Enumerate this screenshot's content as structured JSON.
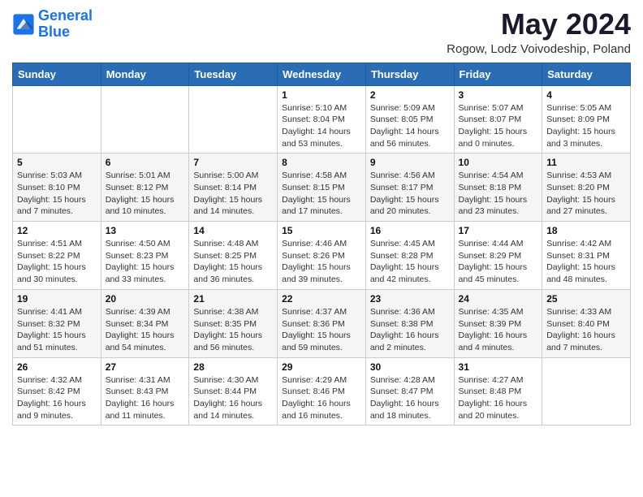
{
  "header": {
    "logo_line1": "General",
    "logo_line2": "Blue",
    "main_title": "May 2024",
    "subtitle": "Rogow, Lodz Voivodeship, Poland"
  },
  "weekdays": [
    "Sunday",
    "Monday",
    "Tuesday",
    "Wednesday",
    "Thursday",
    "Friday",
    "Saturday"
  ],
  "weeks": [
    [
      {
        "day": "",
        "info": ""
      },
      {
        "day": "",
        "info": ""
      },
      {
        "day": "",
        "info": ""
      },
      {
        "day": "1",
        "info": "Sunrise: 5:10 AM\nSunset: 8:04 PM\nDaylight: 14 hours and 53 minutes."
      },
      {
        "day": "2",
        "info": "Sunrise: 5:09 AM\nSunset: 8:05 PM\nDaylight: 14 hours and 56 minutes."
      },
      {
        "day": "3",
        "info": "Sunrise: 5:07 AM\nSunset: 8:07 PM\nDaylight: 15 hours and 0 minutes."
      },
      {
        "day": "4",
        "info": "Sunrise: 5:05 AM\nSunset: 8:09 PM\nDaylight: 15 hours and 3 minutes."
      }
    ],
    [
      {
        "day": "5",
        "info": "Sunrise: 5:03 AM\nSunset: 8:10 PM\nDaylight: 15 hours and 7 minutes."
      },
      {
        "day": "6",
        "info": "Sunrise: 5:01 AM\nSunset: 8:12 PM\nDaylight: 15 hours and 10 minutes."
      },
      {
        "day": "7",
        "info": "Sunrise: 5:00 AM\nSunset: 8:14 PM\nDaylight: 15 hours and 14 minutes."
      },
      {
        "day": "8",
        "info": "Sunrise: 4:58 AM\nSunset: 8:15 PM\nDaylight: 15 hours and 17 minutes."
      },
      {
        "day": "9",
        "info": "Sunrise: 4:56 AM\nSunset: 8:17 PM\nDaylight: 15 hours and 20 minutes."
      },
      {
        "day": "10",
        "info": "Sunrise: 4:54 AM\nSunset: 8:18 PM\nDaylight: 15 hours and 23 minutes."
      },
      {
        "day": "11",
        "info": "Sunrise: 4:53 AM\nSunset: 8:20 PM\nDaylight: 15 hours and 27 minutes."
      }
    ],
    [
      {
        "day": "12",
        "info": "Sunrise: 4:51 AM\nSunset: 8:22 PM\nDaylight: 15 hours and 30 minutes."
      },
      {
        "day": "13",
        "info": "Sunrise: 4:50 AM\nSunset: 8:23 PM\nDaylight: 15 hours and 33 minutes."
      },
      {
        "day": "14",
        "info": "Sunrise: 4:48 AM\nSunset: 8:25 PM\nDaylight: 15 hours and 36 minutes."
      },
      {
        "day": "15",
        "info": "Sunrise: 4:46 AM\nSunset: 8:26 PM\nDaylight: 15 hours and 39 minutes."
      },
      {
        "day": "16",
        "info": "Sunrise: 4:45 AM\nSunset: 8:28 PM\nDaylight: 15 hours and 42 minutes."
      },
      {
        "day": "17",
        "info": "Sunrise: 4:44 AM\nSunset: 8:29 PM\nDaylight: 15 hours and 45 minutes."
      },
      {
        "day": "18",
        "info": "Sunrise: 4:42 AM\nSunset: 8:31 PM\nDaylight: 15 hours and 48 minutes."
      }
    ],
    [
      {
        "day": "19",
        "info": "Sunrise: 4:41 AM\nSunset: 8:32 PM\nDaylight: 15 hours and 51 minutes."
      },
      {
        "day": "20",
        "info": "Sunrise: 4:39 AM\nSunset: 8:34 PM\nDaylight: 15 hours and 54 minutes."
      },
      {
        "day": "21",
        "info": "Sunrise: 4:38 AM\nSunset: 8:35 PM\nDaylight: 15 hours and 56 minutes."
      },
      {
        "day": "22",
        "info": "Sunrise: 4:37 AM\nSunset: 8:36 PM\nDaylight: 15 hours and 59 minutes."
      },
      {
        "day": "23",
        "info": "Sunrise: 4:36 AM\nSunset: 8:38 PM\nDaylight: 16 hours and 2 minutes."
      },
      {
        "day": "24",
        "info": "Sunrise: 4:35 AM\nSunset: 8:39 PM\nDaylight: 16 hours and 4 minutes."
      },
      {
        "day": "25",
        "info": "Sunrise: 4:33 AM\nSunset: 8:40 PM\nDaylight: 16 hours and 7 minutes."
      }
    ],
    [
      {
        "day": "26",
        "info": "Sunrise: 4:32 AM\nSunset: 8:42 PM\nDaylight: 16 hours and 9 minutes."
      },
      {
        "day": "27",
        "info": "Sunrise: 4:31 AM\nSunset: 8:43 PM\nDaylight: 16 hours and 11 minutes."
      },
      {
        "day": "28",
        "info": "Sunrise: 4:30 AM\nSunset: 8:44 PM\nDaylight: 16 hours and 14 minutes."
      },
      {
        "day": "29",
        "info": "Sunrise: 4:29 AM\nSunset: 8:46 PM\nDaylight: 16 hours and 16 minutes."
      },
      {
        "day": "30",
        "info": "Sunrise: 4:28 AM\nSunset: 8:47 PM\nDaylight: 16 hours and 18 minutes."
      },
      {
        "day": "31",
        "info": "Sunrise: 4:27 AM\nSunset: 8:48 PM\nDaylight: 16 hours and 20 minutes."
      },
      {
        "day": "",
        "info": ""
      }
    ]
  ]
}
